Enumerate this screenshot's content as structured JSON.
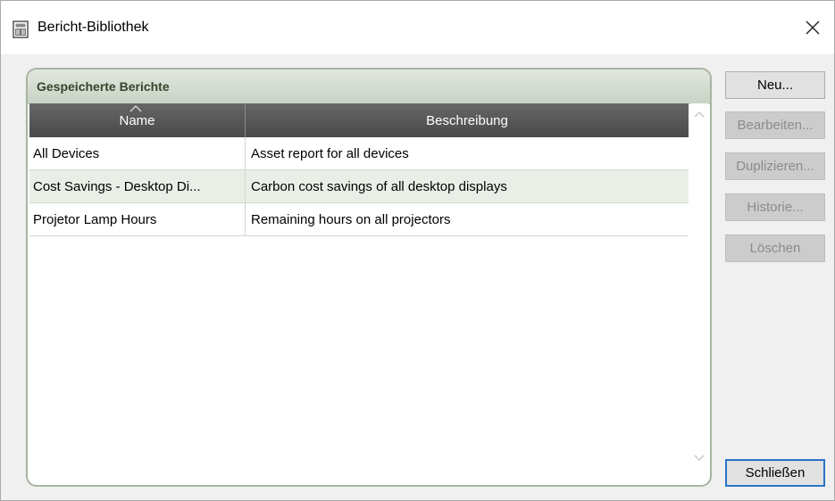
{
  "window": {
    "title": "Bericht-Bibliothek",
    "icon": "report-library-icon"
  },
  "group": {
    "title": "Gespeicherte Berichte"
  },
  "table": {
    "columns": [
      "Name",
      "Beschreibung"
    ],
    "sort_indicator": "ascending",
    "rows": [
      {
        "name": "All Devices",
        "description": "Asset report for all devices"
      },
      {
        "name": "Cost Savings - Desktop Di...",
        "description": "Carbon cost savings of all desktop displays"
      },
      {
        "name": "Projetor Lamp Hours",
        "description": "Remaining hours on all projectors"
      }
    ]
  },
  "buttons": {
    "new": "Neu...",
    "edit": "Bearbeiten...",
    "duplicate": "Duplizieren...",
    "history": "Historie...",
    "delete": "Löschen",
    "close": "Schließen"
  },
  "colors": {
    "group_border": "#a7b5a0",
    "header_dark": "#4a4a4a",
    "alt_row": "#e9efe6",
    "default_button_border": "#2a73c8"
  }
}
